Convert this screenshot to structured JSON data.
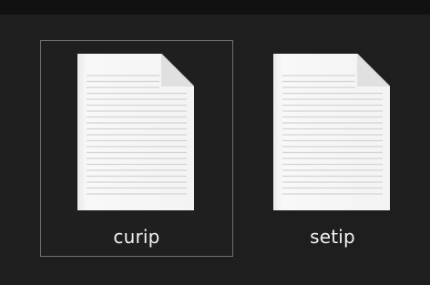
{
  "files": [
    {
      "name": "curip",
      "icon": "text-document-icon",
      "selected": true
    },
    {
      "name": "setip",
      "icon": "text-document-icon",
      "selected": false
    }
  ],
  "colors": {
    "background": "#1e1e1e",
    "selection_border": "#707070",
    "label_text": "#f2f2f2",
    "document_page": "#f7f7f7",
    "document_lines": "#d6d6d6",
    "document_fold": "#e2e2e2"
  }
}
